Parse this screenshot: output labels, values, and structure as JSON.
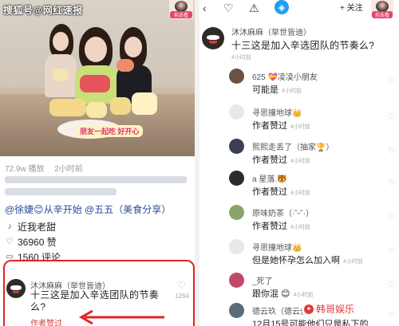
{
  "left": {
    "watermark": "搜狐号@网红速报",
    "sticker_text": "朋友一起吃 好开心",
    "avatar_tag": "前去看",
    "stats": {
      "views": "72.9w 播放",
      "time": "2小时前"
    },
    "mention": "@徐婕😊从辛开始 @五五（美食分享）",
    "music_icon": "music-icon",
    "music_label": "近我老甜",
    "likes": "36960 赞",
    "comments": "1560 评论",
    "comment": {
      "name": "沐沐麻麻（举世皆迪）",
      "text": "十三这是加入辛选团队的节奏么?",
      "author_like": "作者赞过",
      "like_count": "1264"
    },
    "highlight_color": "#e02424"
  },
  "right": {
    "follow_label": "+ 关注",
    "avatar_tag": "前去看",
    "main_comment": {
      "name": "沐沐麻麻（举世皆迪）",
      "text": "十三这是加入辛选团队的节奏么?",
      "time": "4小时前"
    },
    "replies": [
      {
        "name": "625 💝凌凌小朋友",
        "text": "可能是",
        "time": "4小时前",
        "avatar_color": "#6a5244"
      },
      {
        "name": "寻思撞地球👑",
        "text": "作者赞过",
        "time": "4小时前",
        "avatar_color": "#e8e8ec"
      },
      {
        "name": "熙熙走丢了（抽家🏆）",
        "text": "作者赞过",
        "time": "4小时前",
        "avatar_color": "#3a3f52"
      },
      {
        "name": "a    星落.🐯",
        "text": "作者赞过",
        "time": "4小时前",
        "avatar_color": "#2b2b2b"
      },
      {
        "name": "原味奶茶（·˘ᵕ˘·）",
        "text": "作者赞过",
        "time": "4小时前",
        "avatar_color": "#8aa56a"
      },
      {
        "name": "寻思撞地球👑",
        "text": "但是她怀孕怎么加入啊",
        "time": "4小时前",
        "avatar_color": "#e8e8ec"
      },
      {
        "name": "_死了",
        "text": "跟你混 😊",
        "time": "4小时前",
        "avatar_color": "#c04a6a"
      },
      {
        "name": "德云玖（德云佳）",
        "text": "12月15号可能他们只是私下的",
        "time": "",
        "avatar_color": "#5a6b7a"
      }
    ],
    "watermark": "韩哥娱乐"
  }
}
